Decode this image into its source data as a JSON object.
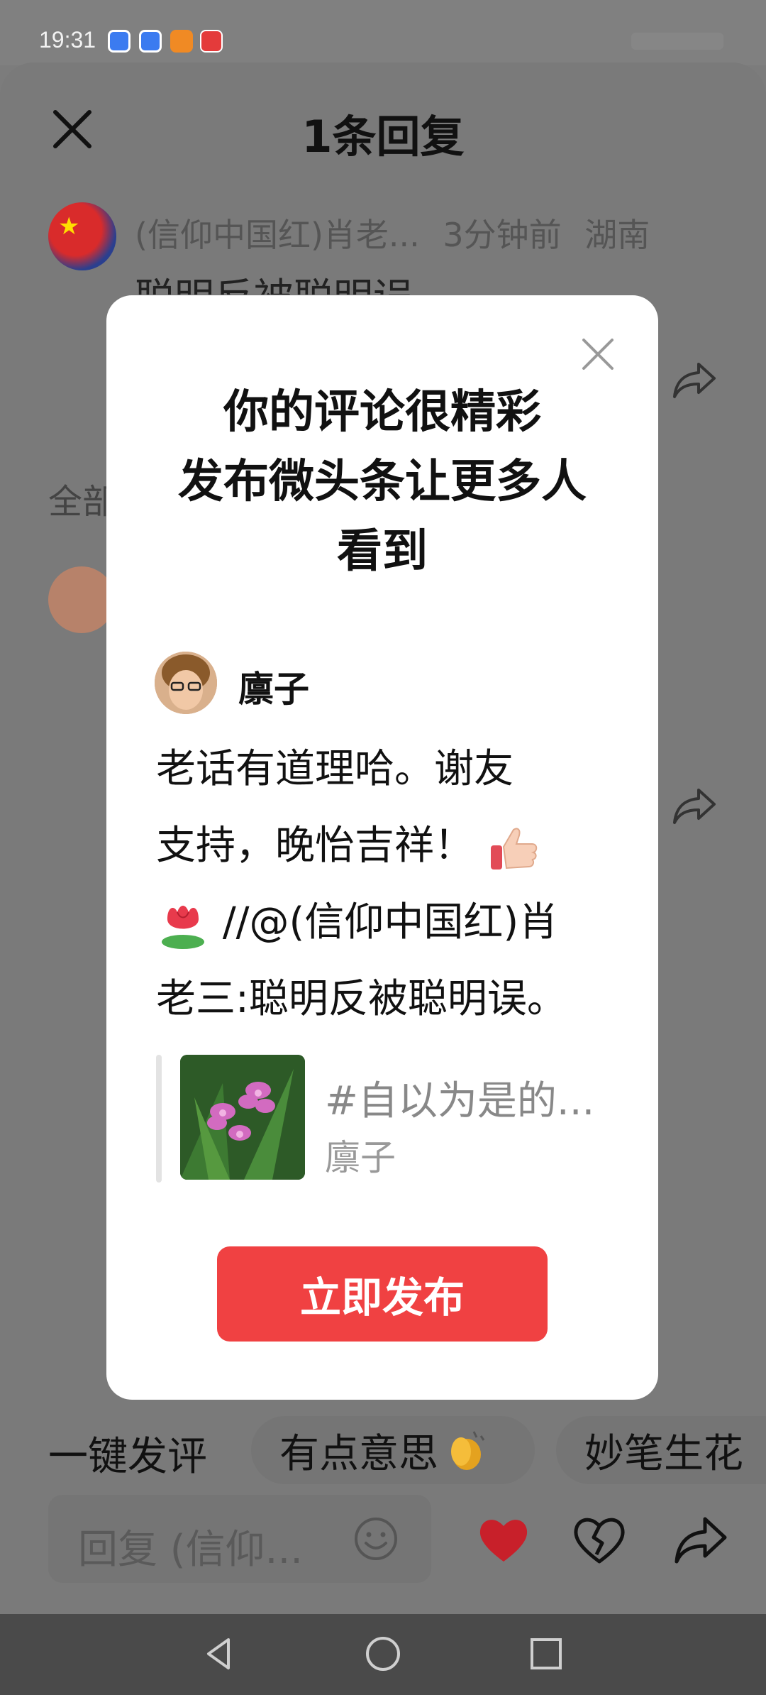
{
  "status_bar": {
    "time": "19:31"
  },
  "sheet": {
    "title": "1条回复",
    "comment": {
      "author": "(信仰中国红)肖老...",
      "time_ago": "3分钟前",
      "location": "湖南",
      "text": "聪明反被聪明误"
    },
    "all_label": "全部"
  },
  "modal": {
    "title_lines": [
      "你的评论很精彩",
      "发布微头条让更多人",
      "看到"
    ],
    "user": "廪子",
    "body_lines": [
      "老话有道理哈。谢友",
      "支持，晚怡吉祥！",
      "//@(信仰中国红)肖",
      "老三:聪明反被聪明误。"
    ],
    "quote": {
      "title": "#自以为是的...",
      "author": "廪子"
    },
    "publish_label": "立即发布"
  },
  "quick_reply": {
    "label": "一键发评",
    "options": [
      "有点意思",
      "妙笔生花"
    ]
  },
  "reply_input": {
    "placeholder": "回复 (信仰..."
  },
  "icons": {
    "close": "close-icon",
    "share": "share-icon",
    "smile": "smile-icon",
    "heart": "heart-icon",
    "broken_heart": "broken-heart-icon",
    "back": "back-icon",
    "home": "home-icon",
    "recents": "recents-icon"
  },
  "colors": {
    "accent": "#f04142",
    "heart": "#c8202a"
  }
}
